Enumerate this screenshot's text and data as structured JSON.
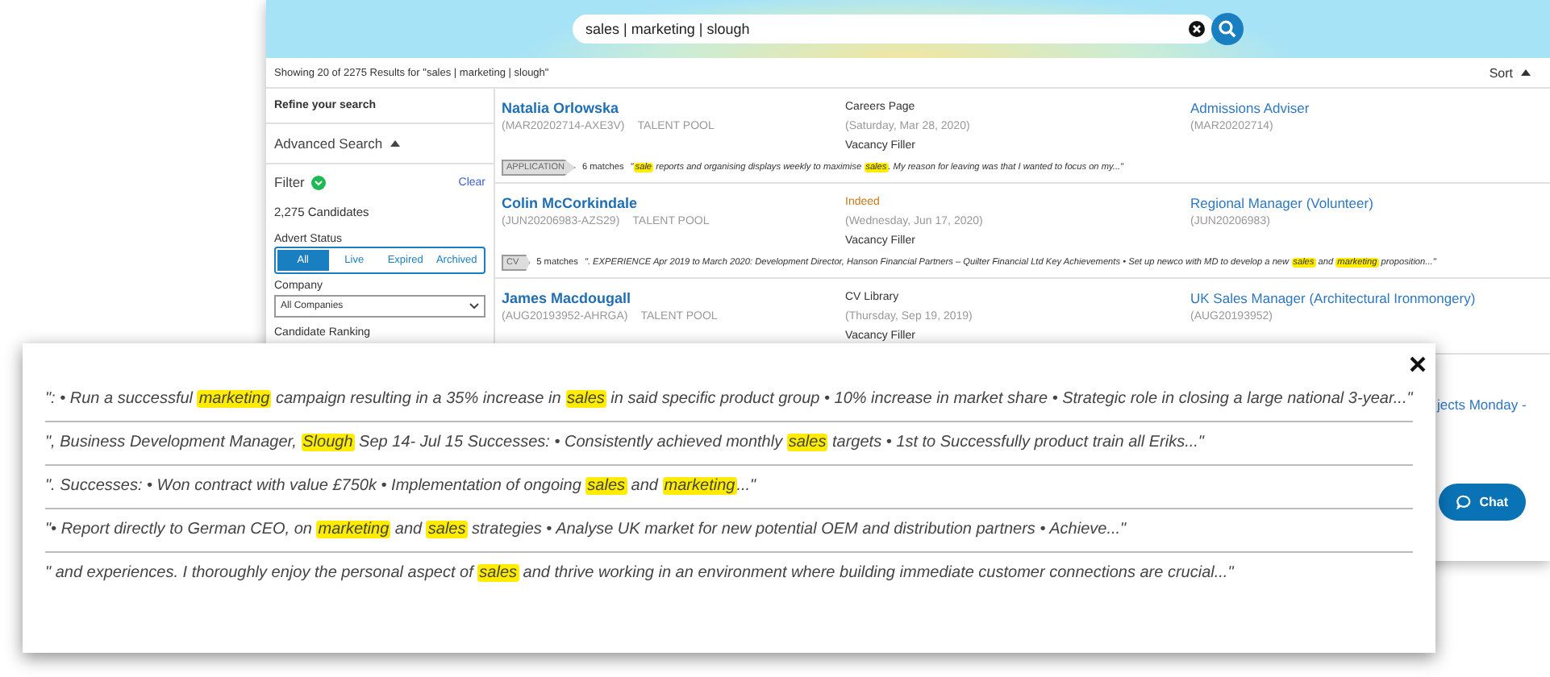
{
  "search": {
    "value": "sales | marketing | slough"
  },
  "results_summary": "Showing 20 of 2275 Results for \"sales | marketing | slough\"",
  "sort": {
    "label": "Sort"
  },
  "sidebar": {
    "title": "Refine your search",
    "advanced_search": {
      "label": "Advanced Search",
      "expanded": true
    },
    "filter": {
      "label": "Filter",
      "clear": "Clear"
    },
    "count": "2,275 Candidates",
    "advert_status": {
      "label": "Advert Status",
      "options": [
        {
          "label": "All",
          "selected": true
        },
        {
          "label": "Live",
          "selected": false
        },
        {
          "label": "Expired",
          "selected": false
        },
        {
          "label": "Archived",
          "selected": false
        }
      ]
    },
    "company": {
      "label": "Company",
      "value": "All Companies"
    },
    "ranking_label": "Candidate Ranking"
  },
  "results": [
    {
      "name": "Natalia Orlowska",
      "ref": "(MAR20202714-AXE3V)",
      "pool": "TALENT POOL",
      "source": "Careers Page",
      "source_highlight": false,
      "date": "(Saturday, Mar 28, 2020)",
      "stage": "Vacancy Filler",
      "job_title": "Admissions Adviser",
      "job_ref": "(MAR20202714)",
      "snippet": {
        "tag": "APPLICATION",
        "matches": "6 matches",
        "segments": [
          {
            "text": "\"",
            "highlight": false
          },
          {
            "text": "sale",
            "highlight": true
          },
          {
            "text": " reports and organising displays weekly to maximise ",
            "highlight": false
          },
          {
            "text": "sales",
            "highlight": true
          },
          {
            "text": ". My reason for leaving was that I wanted to focus on my...\"",
            "highlight": false
          }
        ]
      }
    },
    {
      "name": "Colin McCorkindale",
      "ref": "(JUN20206983-AZS29)",
      "pool": "TALENT POOL",
      "source": "Indeed",
      "source_highlight": true,
      "date": "(Wednesday, Jun 17, 2020)",
      "stage": "Vacancy Filler",
      "job_title": "Regional Manager (Volunteer)",
      "job_ref": "(JUN20206983)",
      "snippet": {
        "tag": "CV",
        "matches": "5 matches",
        "segments": [
          {
            "text": "\". EXPERIENCE Apr 2019 to March 2020: Development Director, Hanson Financial Partners – Quilter Financial Ltd Key Achievements • Set up newco with MD to develop a new ",
            "highlight": false
          },
          {
            "text": "sales",
            "highlight": true
          },
          {
            "text": " and ",
            "highlight": false
          },
          {
            "text": "marketing",
            "highlight": true
          },
          {
            "text": " proposition...\"",
            "highlight": false
          }
        ]
      }
    },
    {
      "name": "James Macdougall",
      "ref": "(AUG20193952-AHRGA)",
      "pool": "TALENT POOL",
      "source": "CV Library",
      "source_highlight": false,
      "date": "(Thursday, Sep 19, 2019)",
      "stage": "Vacancy Filler",
      "job_title": "UK Sales Manager (Architectural Ironmongery)",
      "job_ref": "(AUG20193952)"
    },
    {
      "job_title": "jects Monday -"
    }
  ],
  "chat_button": {
    "label": "Chat"
  },
  "popup": {
    "snippets": [
      [
        {
          "text": "\": • Run a successful ",
          "highlight": false
        },
        {
          "text": "marketing",
          "highlight": true
        },
        {
          "text": " campaign resulting in a 35% increase in ",
          "highlight": false
        },
        {
          "text": "sales",
          "highlight": true
        },
        {
          "text": " in said specific product group • 10% increase in market share • Strategic role in closing a large national 3-year...\"",
          "highlight": false
        }
      ],
      [
        {
          "text": "\", Business Development Manager, ",
          "highlight": false
        },
        {
          "text": "Slough",
          "highlight": true
        },
        {
          "text": " Sep 14- Jul 15 Successes: • Consistently achieved monthly ",
          "highlight": false
        },
        {
          "text": "sales",
          "highlight": true
        },
        {
          "text": " targets • 1st to Successfully product train all Eriks...\"",
          "highlight": false
        }
      ],
      [
        {
          "text": "\". Successes: • Won contract with value £750k • Implementation of ongoing ",
          "highlight": false
        },
        {
          "text": "sales",
          "highlight": true
        },
        {
          "text": " and ",
          "highlight": false
        },
        {
          "text": "marketing",
          "highlight": true
        },
        {
          "text": "...\"",
          "highlight": false
        }
      ],
      [
        {
          "text": "\"• Report directly to German CEO, on ",
          "highlight": false
        },
        {
          "text": "marketing",
          "highlight": true
        },
        {
          "text": " and ",
          "highlight": false
        },
        {
          "text": "sales",
          "highlight": true
        },
        {
          "text": " strategies • Analyse UK market for new potential OEM and distribution partners • Achieve...\"",
          "highlight": false
        }
      ],
      [
        {
          "text": "\" and experiences. I thoroughly enjoy the personal aspect of ",
          "highlight": false
        },
        {
          "text": "sales",
          "highlight": true
        },
        {
          "text": " and thrive working in an environment where building immediate customer connections are crucial...\"",
          "highlight": false
        }
      ]
    ]
  }
}
